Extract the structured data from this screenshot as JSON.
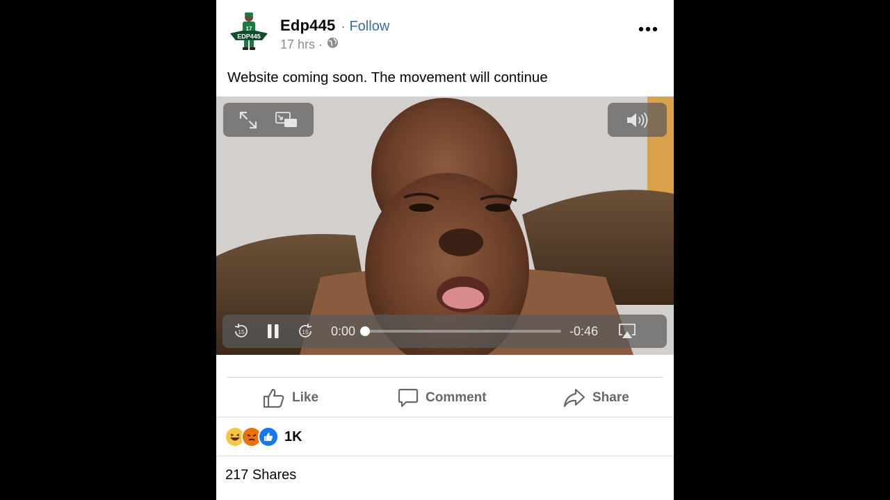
{
  "post": {
    "author": "Edp445",
    "separator": "·",
    "follow_label": "Follow",
    "time_ago": "17 hrs ·",
    "caption": "Website coming soon. The movement will continue",
    "avatar_text": "EDP445"
  },
  "video": {
    "elapsed": "0:00",
    "remaining": "-0:46",
    "progress": 0.0,
    "skip_back_seconds": "15",
    "skip_forward_seconds": "15"
  },
  "actions": {
    "like_label": "Like",
    "comment_label": "Comment",
    "share_label": "Share"
  },
  "engagement": {
    "reaction_count": "1K",
    "reactions": [
      "haha",
      "angry",
      "like"
    ],
    "shares": "217 Shares"
  },
  "colors": {
    "background": "#000000",
    "card": "#ffffff",
    "link": "#3b6fa8",
    "muted": "#65676b",
    "like_blue": "#1877f2"
  }
}
